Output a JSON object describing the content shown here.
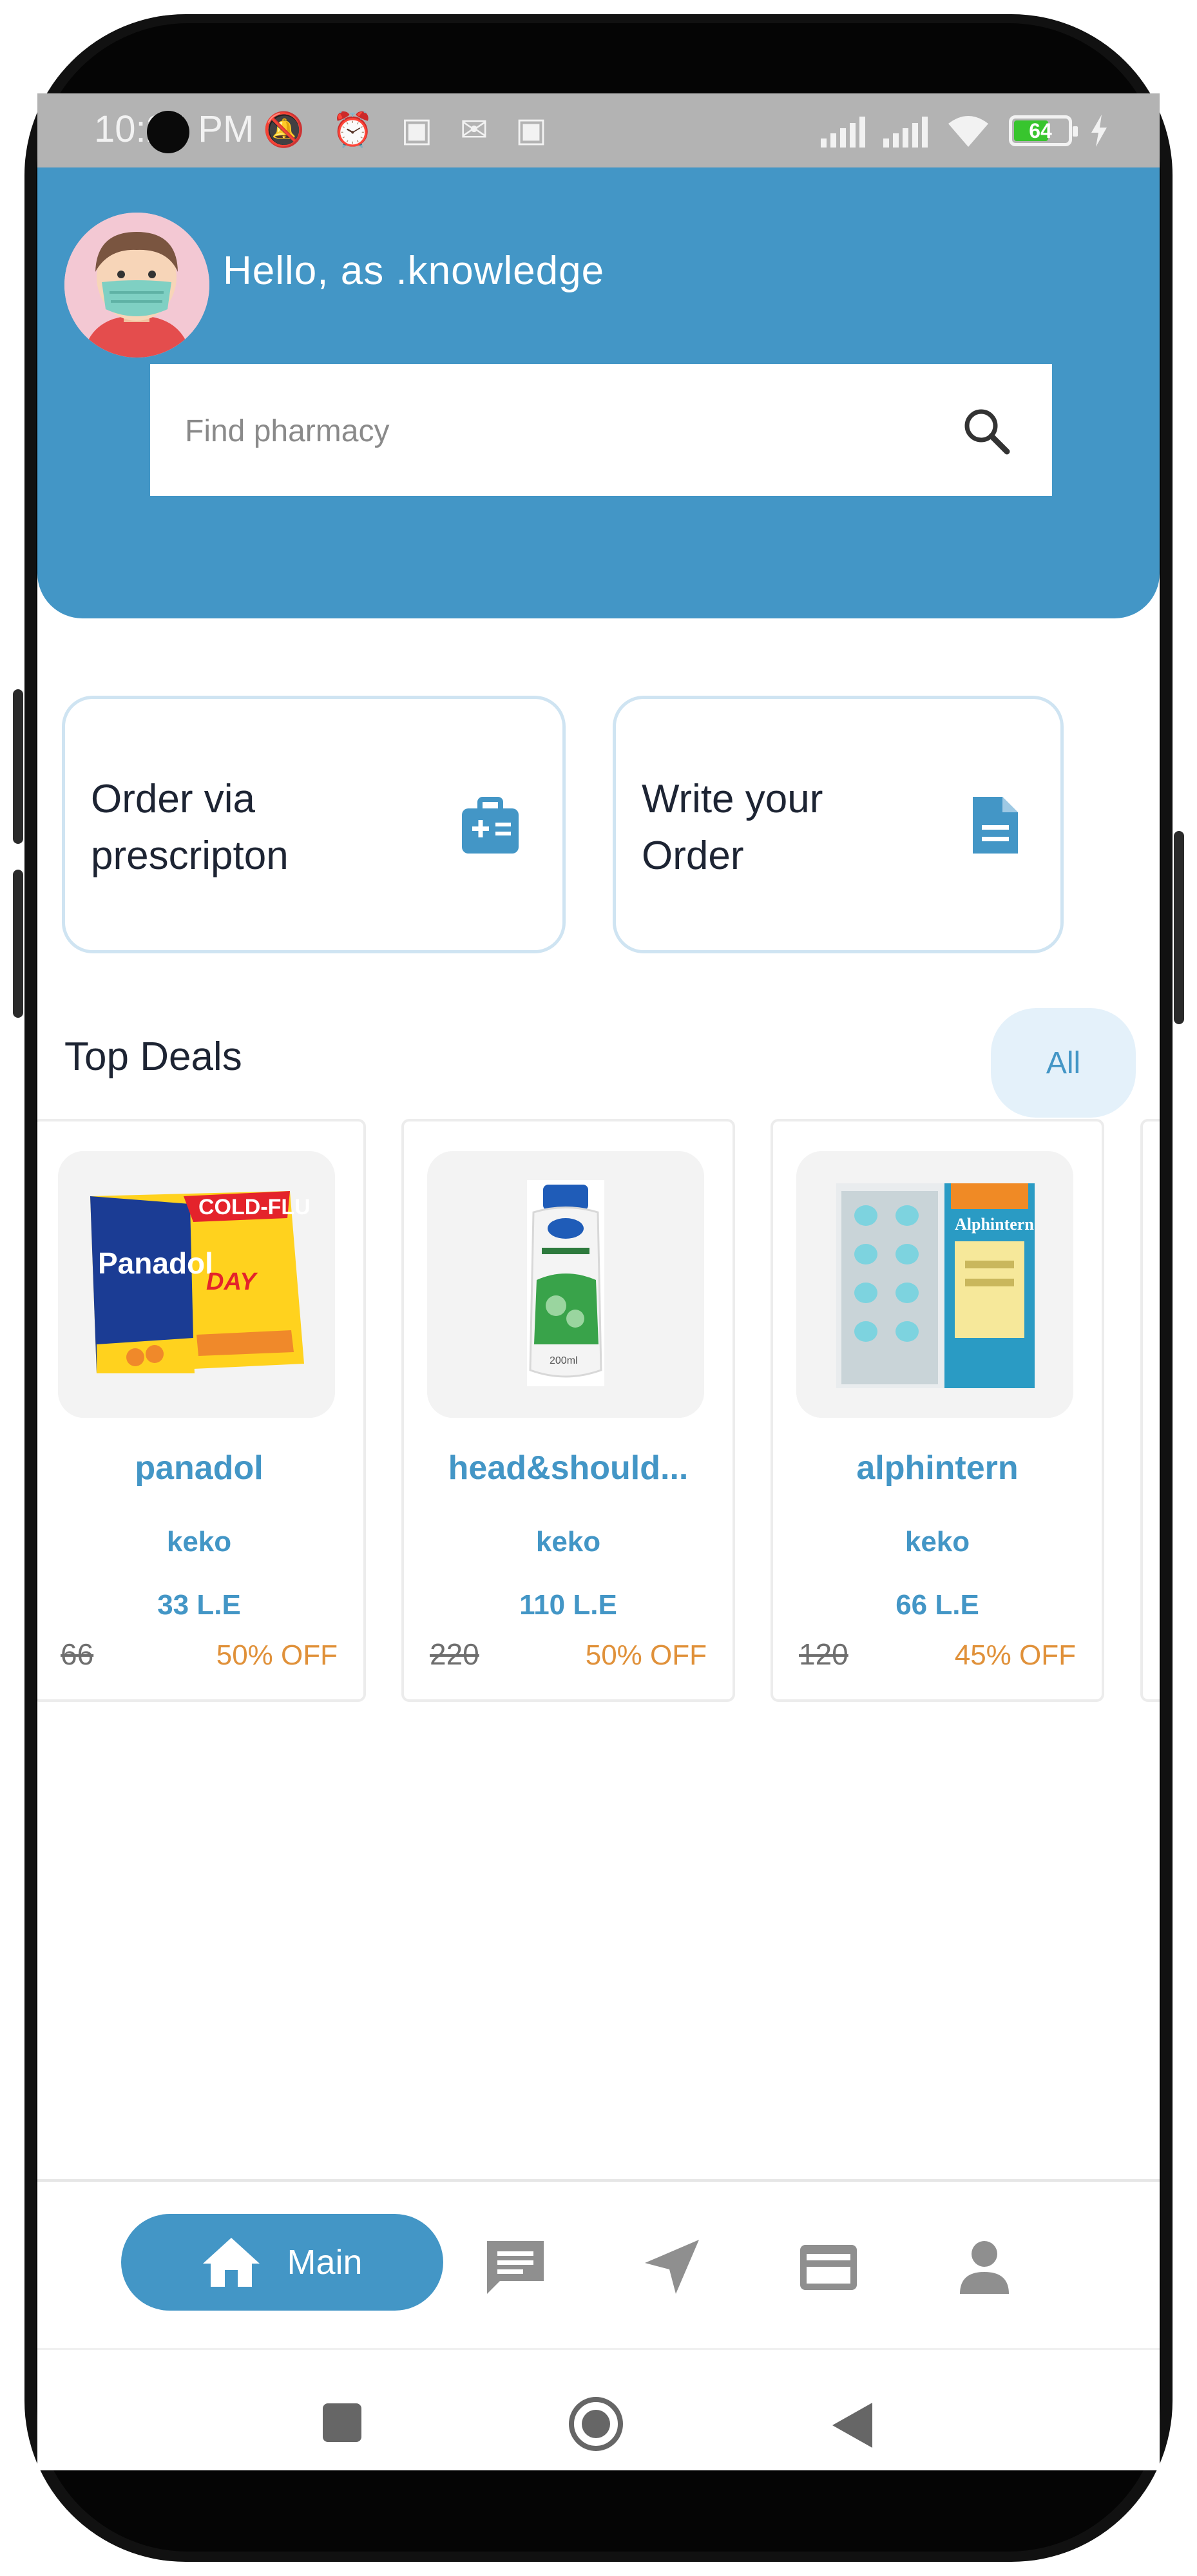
{
  "status_bar": {
    "time": "10:24 PM",
    "battery": "64",
    "icons": [
      "mute-icon",
      "alarm-icon",
      "notification-icon",
      "signal-icon",
      "wifi-icon",
      "battery-icon",
      "charging-icon"
    ]
  },
  "header": {
    "greeting": "Hello, as .knowledge",
    "search_placeholder": "Find pharmacy"
  },
  "actions": [
    {
      "label": "Order via prescripton",
      "icon": "medical-kit-icon"
    },
    {
      "label": "Write your Order",
      "icon": "document-icon"
    }
  ],
  "deals": {
    "title": "Top Deals",
    "all_label": "All",
    "products": [
      {
        "name": "panadol",
        "seller": "keko",
        "price": "33 L.E",
        "old_price": "66",
        "discount": "50% OFF"
      },
      {
        "name": "head&should...",
        "seller": "keko",
        "price": "110 L.E",
        "old_price": "220",
        "discount": "50% OFF"
      },
      {
        "name": "alphintern",
        "seller": "keko",
        "price": "66 L.E",
        "old_price": "120",
        "discount": "45% OFF"
      }
    ]
  },
  "nav": {
    "main_label": "Main",
    "items": [
      "home-icon",
      "chat-icon",
      "navigation-icon",
      "card-icon",
      "profile-icon"
    ]
  },
  "colors": {
    "primary": "#4396c6",
    "discount": "#e0913a",
    "light_blue": "#e4f1fa"
  }
}
